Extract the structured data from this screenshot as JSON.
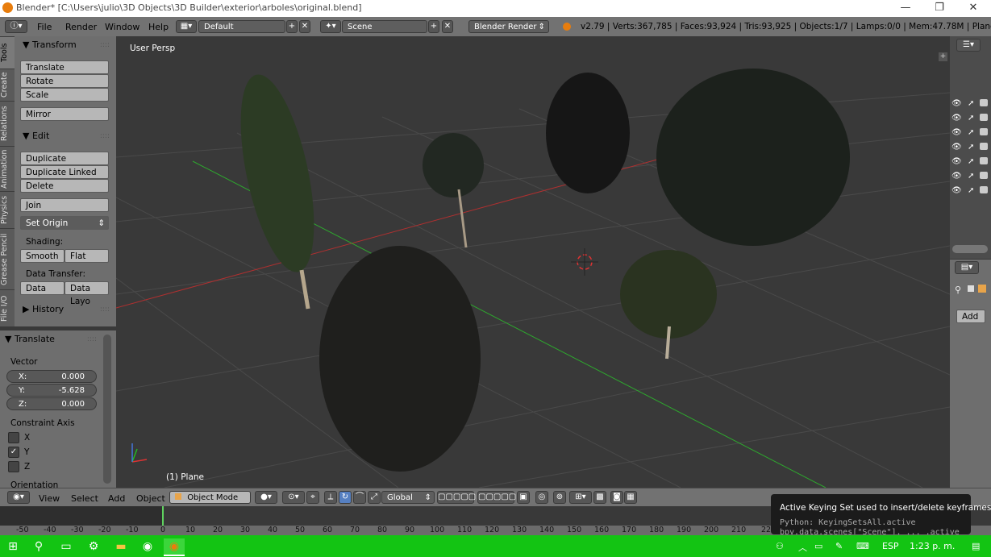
{
  "window": {
    "title": "Blender* [C:\\Users\\julio\\3D Objects\\3D Builder\\exterior\\arboles\\original.blend]",
    "minimize": "—",
    "maximize": "❐",
    "close": "✕"
  },
  "info_header": {
    "menus": [
      "File",
      "Render",
      "Window",
      "Help"
    ],
    "layout": "Default",
    "scene": "Scene",
    "engine": "Blender Render",
    "stats": "v2.79 | Verts:367,785 | Faces:93,924 | Tris:93,925 | Objects:1/7 | Lamps:0/0 | Mem:47.78M | Plane"
  },
  "tool_tabs": [
    "Tools",
    "Create",
    "Relations",
    "Animation",
    "Physics",
    "Grease Pencil",
    "File I/O"
  ],
  "tool_shelf": {
    "transform": {
      "title": "Transform",
      "buttons": [
        "Translate",
        "Rotate",
        "Scale",
        "Mirror"
      ]
    },
    "edit": {
      "title": "Edit",
      "buttons": [
        "Duplicate",
        "Duplicate Linked",
        "Delete",
        "Join"
      ],
      "set_origin": "Set Origin"
    },
    "shading_label": "Shading:",
    "shading_smooth": "Smooth",
    "shading_flat": "Flat",
    "data_transfer_label": "Data Transfer:",
    "data_transfer_data": "Data",
    "data_transfer_layout": "Data Layo",
    "history": "History"
  },
  "operator_panel": {
    "title": "Translate",
    "vector_label": "Vector",
    "x_label": "X:",
    "x_value": "0.000",
    "y_label": "Y:",
    "y_value": "-5.628",
    "z_label": "Z:",
    "z_value": "0.000",
    "constraint_label": "Constraint Axis",
    "axis_x": "X",
    "axis_x_checked": false,
    "axis_y": "Y",
    "axis_y_checked": true,
    "axis_z": "Z",
    "axis_z_checked": false,
    "orientation_label": "Orientation"
  },
  "viewport": {
    "view_label": "User Persp",
    "object_label": "(1) Plane"
  },
  "properties": {
    "add_button": "Add"
  },
  "view_header": {
    "menus": [
      "View",
      "Select",
      "Add",
      "Object"
    ],
    "mode": "Object Mode",
    "orientation": "Global"
  },
  "timeline": {
    "ticks": [
      "-50",
      "-40",
      "-30",
      "-20",
      "-10",
      "0",
      "10",
      "20",
      "30",
      "40",
      "50",
      "60",
      "70",
      "80",
      "90",
      "100",
      "110",
      "120",
      "130",
      "140",
      "150",
      "160",
      "170",
      "180",
      "190",
      "200",
      "210",
      "22"
    ],
    "current_frame": 1
  },
  "tooltip": {
    "heading": "Active Keying Set used to insert/delete keyframes.",
    "python1": "Python: KeyingSetsAll.active",
    "python2": "bpy.data.scenes[\"Scene\"]. ... .active"
  },
  "taskbar": {
    "language": "ESP",
    "time": "1:23 p. m."
  },
  "colors": {
    "taskbar": "#13c413",
    "grid_x_axis": "#b03030",
    "grid_y_axis": "#2ea82e",
    "panel_bg": "#6e6e6e",
    "viewport_bg": "#393939"
  }
}
